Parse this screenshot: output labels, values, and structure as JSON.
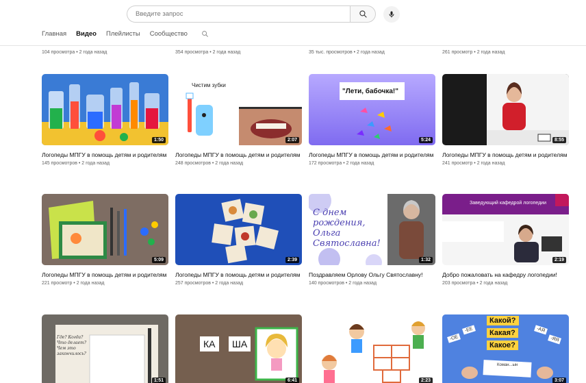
{
  "header": {
    "search_placeholder": "Введите запрос",
    "search_icon": "search-icon",
    "mic_icon": "microphone-icon"
  },
  "tabs": [
    {
      "label": "Главная",
      "active": false
    },
    {
      "label": "Видео",
      "active": true
    },
    {
      "label": "Плейлисты",
      "active": false
    },
    {
      "label": "Сообщество",
      "active": false
    }
  ],
  "top_partial_row": [
    {
      "meta": "104 просмотра • 2 года назад"
    },
    {
      "meta": "354 просмотра • 2 года назад"
    },
    {
      "meta": "35 тыс. просмотров • 2 года назад"
    },
    {
      "meta": "261 просмотр • 2 года назад"
    }
  ],
  "videos": [
    {
      "title": "Логопеды МПГУ в помощь детям и родителям",
      "meta": "145 просмотров • 2 года назад",
      "duration": "1:50",
      "thumb": "lab-glassware"
    },
    {
      "title": "Логопеды МПГУ в помощь детям и родителям",
      "meta": "248 просмотров • 2 года назад",
      "duration": "2:07",
      "thumb": "toothbrush",
      "overlay": "Чистим зубки"
    },
    {
      "title": "Логопеды МПГУ в помощь детям и родителям",
      "meta": "172 просмотра • 2 года назад",
      "duration": "5:24",
      "thumb": "butterflies",
      "overlay": "\"Лети, бабочка!\""
    },
    {
      "title": "Логопеды МПГУ в помощь детям и родителям",
      "meta": "241 просмотр • 2 года назад",
      "duration": "8:55",
      "thumb": "woman-table"
    },
    {
      "title": "Логопеды МПГУ в помощь детям и родителям",
      "meta": "221 просмотр • 2 года назад",
      "duration": "5:09",
      "thumb": "craft-materials"
    },
    {
      "title": "Логопеды МПГУ в помощь детям и родителям",
      "meta": "257 просмотров • 2 года назад",
      "duration": "2:39",
      "thumb": "picture-cards"
    },
    {
      "title": "Поздравляем Орлову Ольгу Святославну!",
      "meta": "140 просмотров • 2 года назад",
      "duration": "1:32",
      "thumb": "birthday",
      "overlay": "С днем рождения, Ольга Святославна!"
    },
    {
      "title": "Добро пожаловать на кафедру логопедии!",
      "meta": "203 просмотра • 2 года назад",
      "duration": "2:19",
      "thumb": "head-of-dept",
      "overlay": "Заведующий кафедрой логопедии"
    },
    {
      "title": "",
      "meta": "",
      "duration": "1:51",
      "thumb": "paper-notes",
      "overlay": "Где? Когда? Что делает? Чем это закончилось?"
    },
    {
      "title": "",
      "meta": "",
      "duration": "6:41",
      "thumb": "syllables",
      "overlay_a": "КА",
      "overlay_b": "ША"
    },
    {
      "title": "",
      "meta": "",
      "duration": "2:23",
      "thumb": "kids-hopscotch"
    },
    {
      "title": "",
      "meta": "",
      "duration": "3:07",
      "thumb": "word-cards",
      "w1": "Какой?",
      "w2": "Какая?",
      "w3": "Какое?",
      "s1": "-ОЕ",
      "s2": "-ЕЕ",
      "s3": "-АЯ",
      "s4": "-ЯЯ",
      "caption": "Коман...ын"
    }
  ]
}
